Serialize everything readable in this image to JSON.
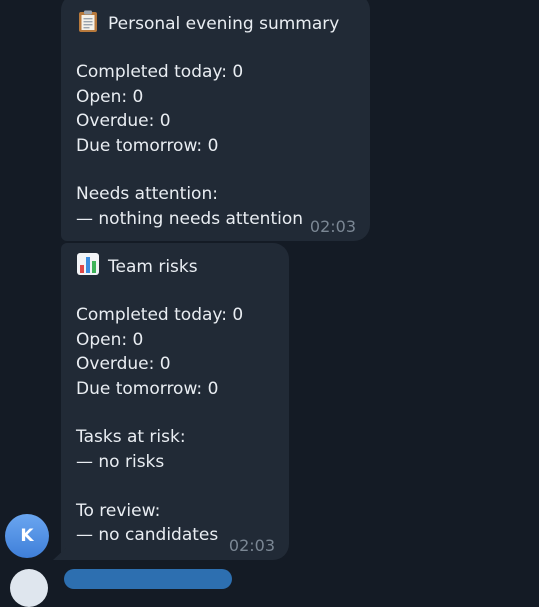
{
  "messages": [
    {
      "title_icon": "clipboard-icon",
      "title": "Personal evening summary",
      "lines": [
        "Completed today: 0",
        "Open: 0",
        "Overdue: 0",
        "Due tomorrow: 0",
        "",
        "Needs attention:",
        "— nothing needs attention"
      ],
      "time": "02:03"
    },
    {
      "title_icon": "bar-chart-icon",
      "title": "Team risks",
      "lines": [
        "Completed today: 0",
        "Open: 0",
        "Overdue: 0",
        "Due tomorrow: 0",
        "",
        "Tasks at risk:",
        "— no risks",
        "",
        "To review:",
        "— no candidates"
      ],
      "time": "02:03"
    }
  ],
  "sender": {
    "avatar_initial": "K",
    "avatar_color": "#4f8fe3"
  },
  "colors": {
    "background": "#141b25",
    "bubble": "#212a36",
    "timestamp": "#7b8794"
  }
}
